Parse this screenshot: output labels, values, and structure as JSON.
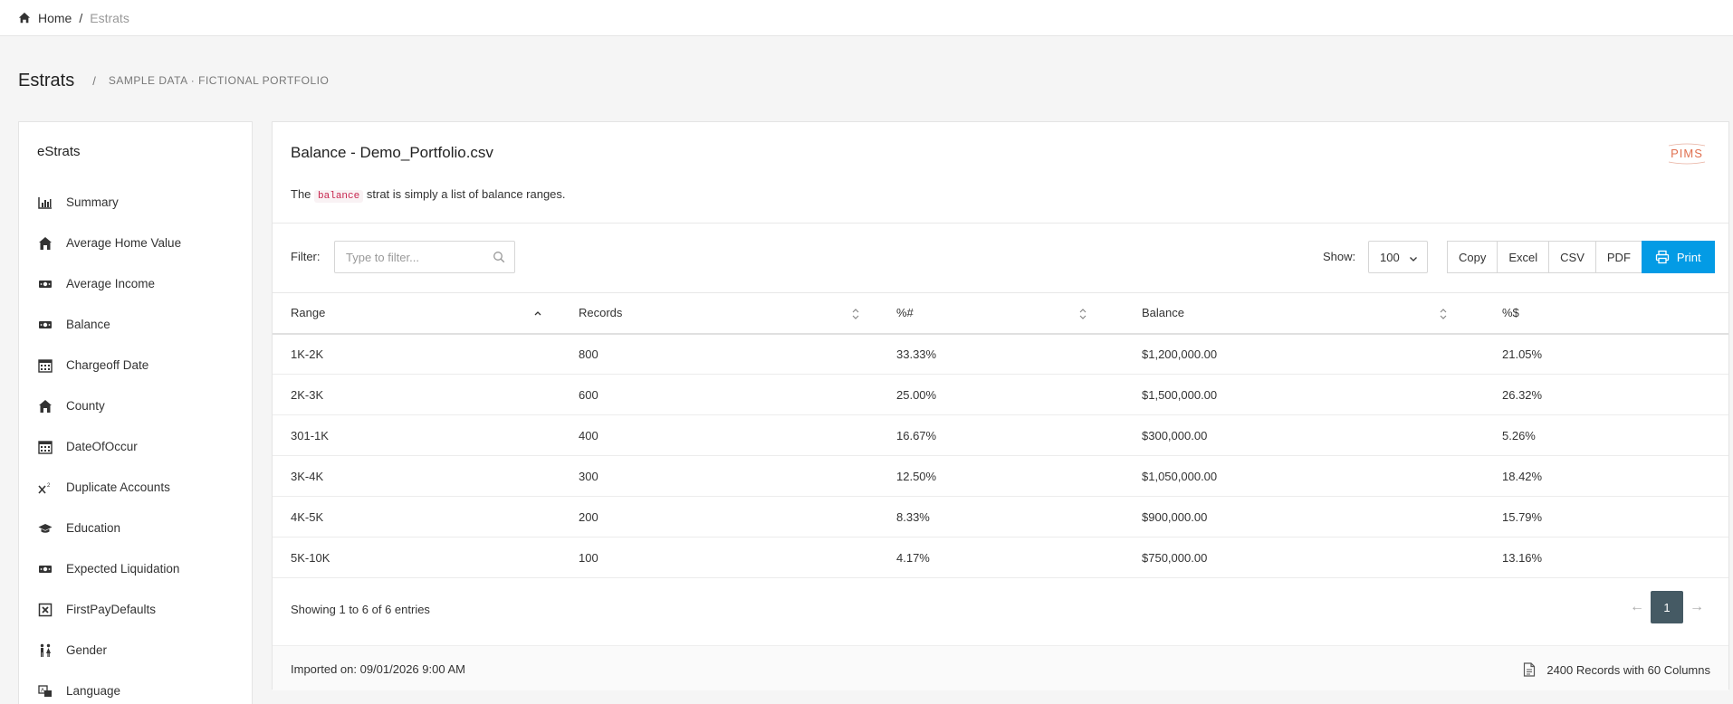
{
  "breadcrumb": {
    "home": "Home",
    "separator": "/",
    "current": "Estrats",
    "home_icon": "home-icon"
  },
  "page": {
    "title": "Estrats",
    "separator": "/",
    "subtitle": "SAMPLE DATA · FICTIONAL PORTFOLIO"
  },
  "sidebar": {
    "title": "eStrats",
    "items": [
      {
        "label": "Summary",
        "icon": "bar-chart-icon"
      },
      {
        "label": "Average Home Value",
        "icon": "house-icon"
      },
      {
        "label": "Average Income",
        "icon": "money-icon"
      },
      {
        "label": "Balance",
        "icon": "money-icon"
      },
      {
        "label": "Chargeoff Date",
        "icon": "calendar-icon"
      },
      {
        "label": "County",
        "icon": "house-icon"
      },
      {
        "label": "DateOfOccur",
        "icon": "calendar-icon"
      },
      {
        "label": "Duplicate Accounts",
        "icon": "superscript-icon"
      },
      {
        "label": "Education",
        "icon": "graduation-cap-icon"
      },
      {
        "label": "Expected Liquidation",
        "icon": "money-icon"
      },
      {
        "label": "FirstPayDefaults",
        "icon": "x-square-icon"
      },
      {
        "label": "Gender",
        "icon": "people-icon"
      },
      {
        "label": "Language",
        "icon": "language-icon"
      }
    ]
  },
  "panel": {
    "title": "Balance - Demo_Portfolio.csv",
    "logo_text": "PIMS",
    "description_prefix": "The",
    "description_code": "balance",
    "description_suffix": "strat is simply a list of balance ranges.",
    "filter_label": "Filter:",
    "filter_placeholder": "Type to filter...",
    "filter_value": "",
    "show_label": "Show:",
    "show_value": "100",
    "buttons": {
      "copy": "Copy",
      "excel": "Excel",
      "csv": "CSV",
      "pdf": "PDF",
      "print": "Print"
    },
    "columns": [
      "Range",
      "Records",
      "%#",
      "Balance",
      "%$"
    ],
    "rows": [
      [
        "1K-2K",
        "800",
        "33.33%",
        "$1,200,000.00",
        "21.05%"
      ],
      [
        "2K-3K",
        "600",
        "25.00%",
        "$1,500,000.00",
        "26.32%"
      ],
      [
        "301-1K",
        "400",
        "16.67%",
        "$300,000.00",
        "5.26%"
      ],
      [
        "3K-4K",
        "300",
        "12.50%",
        "$1,050,000.00",
        "18.42%"
      ],
      [
        "4K-5K",
        "200",
        "8.33%",
        "$900,000.00",
        "15.79%"
      ],
      [
        "5K-10K",
        "100",
        "4.17%",
        "$750,000.00",
        "13.16%"
      ]
    ],
    "showing": "Showing 1 to 6 of 6 entries",
    "pagination": {
      "prev": "←",
      "current": "1",
      "next": "→"
    },
    "imported": "Imported on: 09/01/2026 9:00 AM",
    "records_summary": "2400 Records with 60 Columns"
  },
  "colors": {
    "accent": "#039be5",
    "pager_active": "#455a64",
    "code_text": "#c7254e",
    "logo": "#e07050"
  }
}
